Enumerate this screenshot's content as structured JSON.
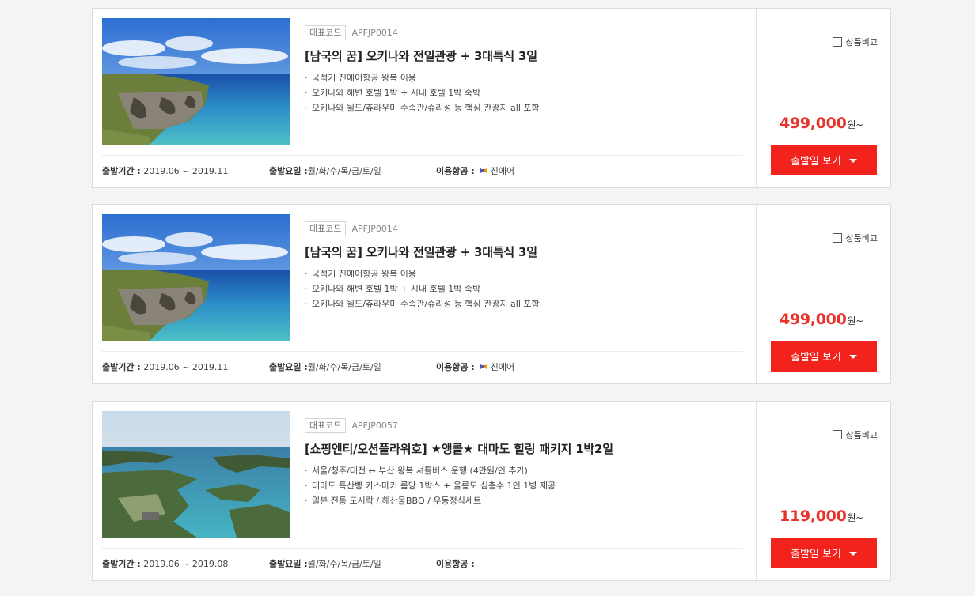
{
  "products": [
    {
      "code_label": "대표코드",
      "code": "APFJP0014",
      "title": "[남국의 꿈] 오키나와 전일관광 + 3대특식 3일",
      "features": [
        "국적기 진에어항공 왕복 이용",
        "오키나와 해변 호텔 1박 + 시내 호텔 1박 숙박",
        "오키나와 월드/츄라우미 수족관/슈리성 등 핵심 관광지 all 포함"
      ],
      "period_label": "출발기간 :",
      "period": "2019.06 ~ 2019.11",
      "days_label": "출발요일 :",
      "days": "월/화/수/목/금/토/일",
      "airline_label": "이용항공 :",
      "airline": "진에어",
      "airline_icon": "jinair-logo-icon",
      "compare_label": "상품비교",
      "price": "499,000",
      "price_unit": "원~",
      "button_label": "출발일 보기"
    },
    {
      "code_label": "대표코드",
      "code": "APFJP0014",
      "title": "[남국의 꿈] 오키나와 전일관광 + 3대특식 3일",
      "features": [
        "국적기 진에어항공 왕복 이용",
        "오키나와 해변 호텔 1박 + 시내 호텔 1박 숙박",
        "오키나와 월드/츄라우미 수족관/슈리성 등 핵심 관광지 all 포함"
      ],
      "period_label": "출발기간 :",
      "period": "2019.06 ~ 2019.11",
      "days_label": "출발요일 :",
      "days": "월/화/수/목/금/토/일",
      "airline_label": "이용항공 :",
      "airline": "진에어",
      "airline_icon": "jinair-logo-icon",
      "compare_label": "상품비교",
      "price": "499,000",
      "price_unit": "원~",
      "button_label": "출발일 보기"
    },
    {
      "code_label": "대표코드",
      "code": "APFJP0057",
      "title": "[쇼핑엔티/오션플라워호] ★앵콜★ 대마도 힐링 패키지 1박2일",
      "features": [
        "서울/청주/대전 ↔ 부산 왕복 셔틀버스 운행 (4만원/인 추가)",
        "대마도 특산빵 카스마키 롬당 1박스 + 울릉도 심층수 1인 1병 제공",
        "일본 전통 도시락 / 해산물BBQ / 우동정식세트"
      ],
      "period_label": "출발기간 :",
      "period": "2019.06 ~ 2019.08",
      "days_label": "출발요일 :",
      "days": "월/화/수/목/금/토/일",
      "airline_label": "이용항공 :",
      "airline": "",
      "compare_label": "상품비교",
      "price": "119,000",
      "price_unit": "원~",
      "button_label": "출발일 보기"
    }
  ],
  "colors": {
    "price": "#e8332a",
    "button": "#f2221c"
  }
}
